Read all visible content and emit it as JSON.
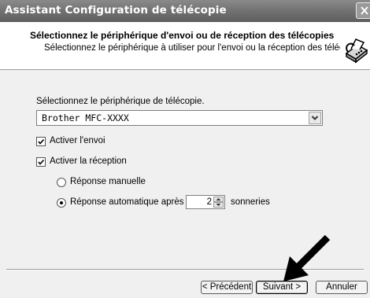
{
  "window": {
    "title": "Assistant Configuration de télécopie"
  },
  "header": {
    "title": "Sélectionnez le périphérique d'envoi ou de réception des télécopies",
    "subtitle": "Sélectionnez le périphérique à utiliser pour l'envoi ou la réception des télécopies."
  },
  "device": {
    "label": "Sélectionnez le périphérique de télécopie.",
    "selected": "Brother MFC-XXXX"
  },
  "options": {
    "send_label": "Activer l'envoi",
    "send_checked": true,
    "receive_label": "Activer la réception",
    "receive_checked": true,
    "manual_label": "Réponse manuelle",
    "manual_selected": false,
    "auto_label": "Réponse automatique après",
    "auto_selected": true,
    "rings_value": "2",
    "rings_unit": "sonneries"
  },
  "buttons": {
    "back": "< Précédent",
    "next": "Suivant >",
    "cancel": "Annuler"
  }
}
